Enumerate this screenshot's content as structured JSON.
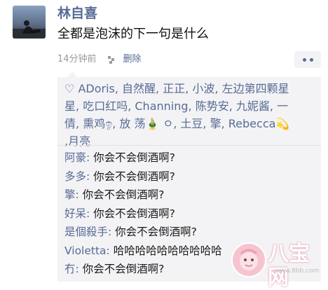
{
  "post": {
    "username": "林自喜",
    "text": "全都是泡沫的下一句是什么",
    "time": "14分钟前",
    "delete_label": "删除"
  },
  "likes": {
    "names": [
      "ADoris,",
      "自然醒,",
      "正正,",
      "小波,",
      "左边第四颗星",
      "星,",
      "吃口红吗,",
      "Channing,",
      "陈势安,",
      "九妮酱,",
      "一",
      "倩,",
      "熏鸡ඉ,",
      "放 荡",
      "🎍",
      "ㅇ,",
      "土豆,",
      "擎,",
      "Rebecca",
      "💫",
      ",",
      "月亮"
    ]
  },
  "comments": [
    {
      "name": "阿豪:",
      "text": "你会不会倒酒啊?"
    },
    {
      "name": "多多:",
      "text": "你会不会倒酒啊?"
    },
    {
      "name": "擎:",
      "text": "你会不会倒酒啊?"
    },
    {
      "name": "好呆:",
      "text": "你会不会倒酒啊?"
    },
    {
      "name": "是個殺手:",
      "text": "你会不会倒酒啊?"
    },
    {
      "name": "Violetta:",
      "text": "哈哈哈哈哈哈哈哈哈哈"
    },
    {
      "name": "冇:",
      "text": "你会不会倒酒啊?"
    }
  ],
  "watermark": {
    "text": "八宝网",
    "url": "www.8bb.com"
  },
  "icons": {
    "pin": "pin-icon",
    "more": "more-dots-icon",
    "heart": "heart-outline-icon"
  },
  "colors": {
    "link": "#576b95",
    "panel_bg": "#f3f3f5"
  }
}
